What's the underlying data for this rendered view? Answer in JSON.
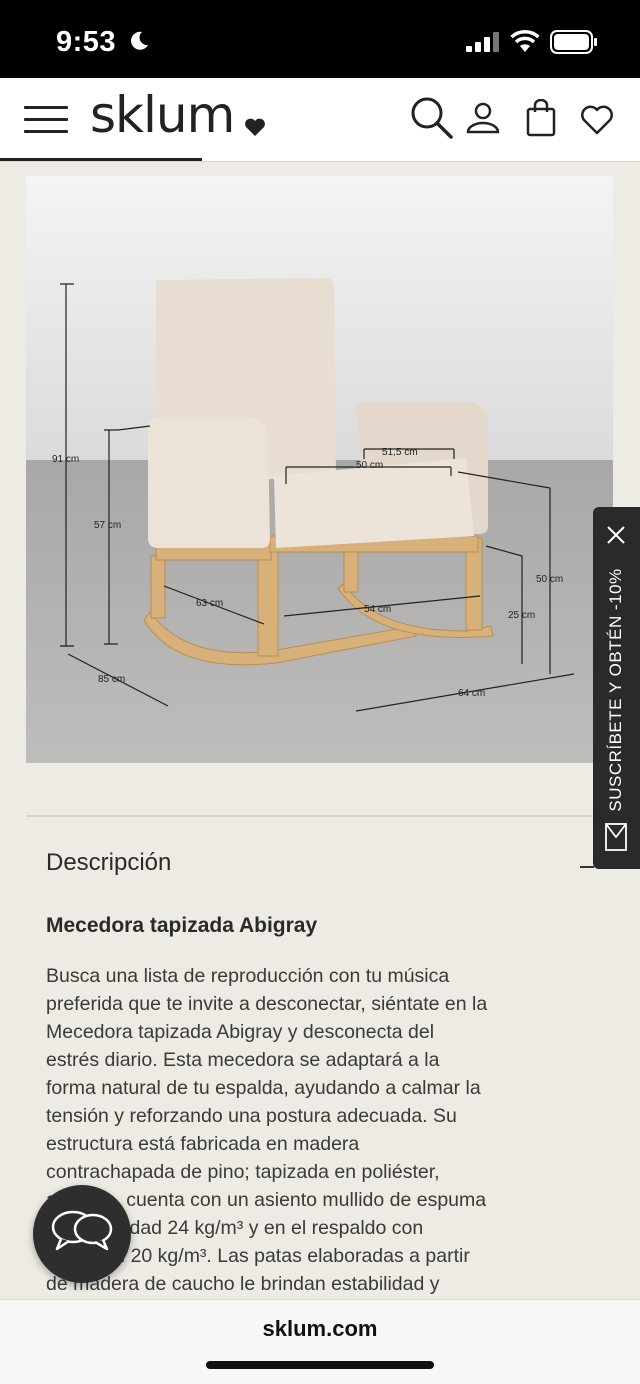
{
  "status": {
    "time": "9:53"
  },
  "header": {
    "logo": "sklum",
    "icons": [
      "menu-icon",
      "search-icon",
      "user-icon",
      "bag-icon",
      "heart-icon"
    ]
  },
  "product_image": {
    "dimensions": {
      "height_total": "91 cm",
      "back_height": "57 cm",
      "depth": "85 cm",
      "inner_width": "51,5 cm",
      "seat_width": "50 cm",
      "side_depth": "63 cm",
      "base_width": "54 cm",
      "seat_height": "50 cm",
      "rocker_height": "25 cm",
      "total_width": "64 cm"
    }
  },
  "description": {
    "title": "Descripción",
    "product_name": "Mecedora tapizada Abigray",
    "lines": [
      "Busca una lista de reproducción con tu música",
      "preferida que te invite a desconectar, siéntate en la",
      "Mecedora tapizada Abigray y desconecta del",
      "estrés diario. Esta mecedora se adaptará a la",
      "forma natural de tu espalda, ayudando a calmar la",
      "tensión y reforzando una postura adecuada. Su",
      "estructura está fabricada en madera",
      "contrachapada de pino; tapizada en poliéster,",
      "además, cuenta con un asiento mullido de espuma",
      "con densidad 24 kg/m³ y en el respaldo con",
      "densidad 20 kg/m³. Las patas elaboradas a partir",
      "de madera de caucho le brindan estabilidad y"
    ]
  },
  "side_tab": {
    "label": "SUSCRÍBETE Y OBTÉN -10%"
  },
  "url_bar": {
    "url": "sklum.com"
  }
}
